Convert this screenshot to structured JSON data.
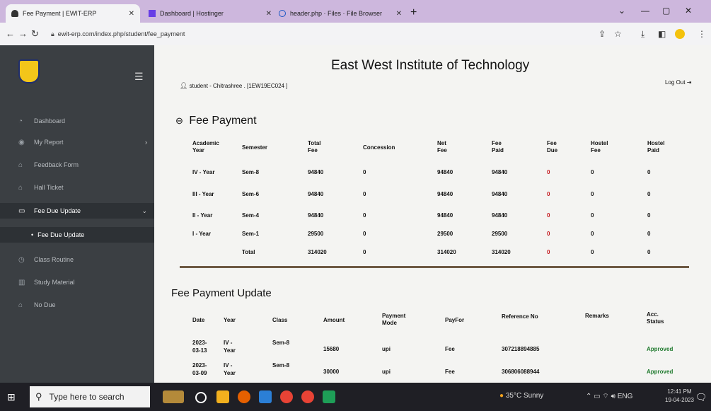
{
  "browser": {
    "tabs": [
      {
        "label": "Fee Payment | EWIT-ERP"
      },
      {
        "label": "Dashboard | Hostinger"
      },
      {
        "label": "header.php · Files · File Browser"
      }
    ],
    "url": "ewit-erp.com/index.php/student/fee_payment"
  },
  "sidebar": {
    "items": [
      {
        "label": "Dashboard",
        "icon": "dashboard-icon"
      },
      {
        "label": "My Report",
        "icon": "report-icon"
      },
      {
        "label": "Feedback Form",
        "icon": "feedback-icon"
      },
      {
        "label": "Hall Ticket",
        "icon": "ticket-icon"
      },
      {
        "label": "Fee Due Update",
        "icon": "card-icon"
      },
      {
        "label": "Fee Due Update"
      },
      {
        "label": "Class Routine",
        "icon": "clock-icon"
      },
      {
        "label": "Study Material",
        "icon": "book-icon"
      },
      {
        "label": "No Due",
        "icon": "nodue-icon"
      }
    ]
  },
  "header": {
    "title": "East West Institute of Technology",
    "user": "student - Chitrashree . [1EW19EC024 ]",
    "logout": "Log Out"
  },
  "fee_payment": {
    "title": "Fee Payment",
    "columns": [
      "Academic Year",
      "Semester",
      "Total Fee",
      "Concession",
      "Net Fee",
      "Fee Paid",
      "Fee Due",
      "Hostel Fee",
      "Hostel Paid"
    ],
    "rows": [
      [
        "IV - Year",
        "Sem-8",
        "94840",
        "0",
        "94840",
        "94840",
        "0",
        "0",
        "0"
      ],
      [
        "III - Year",
        "Sem-6",
        "94840",
        "0",
        "94840",
        "94840",
        "0",
        "0",
        "0"
      ],
      [
        "II - Year",
        "Sem-4",
        "94840",
        "0",
        "94840",
        "94840",
        "0",
        "0",
        "0"
      ],
      [
        "I - Year",
        "Sem-1",
        "29500",
        "0",
        "29500",
        "29500",
        "0",
        "0",
        "0"
      ],
      [
        "",
        "Total",
        "314020",
        "0",
        "314020",
        "314020",
        "0",
        "0",
        "0"
      ]
    ]
  },
  "fee_payment_update": {
    "title": "Fee Payment Update",
    "columns": [
      "Date",
      "Year",
      "Class",
      "Amount",
      "Payment Mode",
      "PayFor",
      "Reference No",
      "Remarks",
      "Acc. Status"
    ],
    "rows": [
      [
        "2023-03-13",
        "IV - Year",
        "Sem-8",
        "15680",
        "upi",
        "Fee",
        "307218894885",
        "",
        "Approved"
      ],
      [
        "2023-03-09",
        "IV - Year",
        "Sem-8",
        "30000",
        "upi",
        "Fee",
        "306806088944",
        "",
        "Approved"
      ]
    ]
  },
  "taskbar": {
    "search_placeholder": "Type here to search",
    "weather": "35°C Sunny",
    "lang": "ENG",
    "time": "12:41 PM",
    "date": "19-04-2023"
  }
}
